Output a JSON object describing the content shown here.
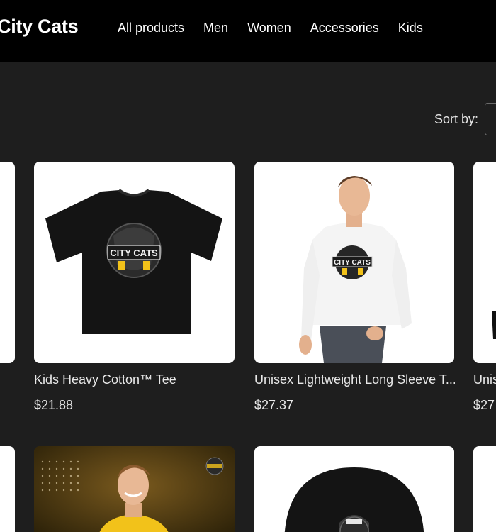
{
  "brand": {
    "name": "City Cats"
  },
  "nav": {
    "items": [
      "All products",
      "Men",
      "Women",
      "Accessories",
      "Kids"
    ]
  },
  "sort": {
    "label": "Sort by:"
  },
  "products": [
    {
      "title": "Kids Heavy Cotton™ Tee",
      "price": "$21.88",
      "logo_text": "CITY CATS"
    },
    {
      "title": "Unisex Lightweight Long Sleeve T...",
      "price": "$27.37",
      "logo_text": "CITY CATS"
    },
    {
      "title": "Unis",
      "price": "$27"
    }
  ],
  "colors": {
    "header_bg": "#000000",
    "page_bg": "#1e1e1e",
    "card_bg": "#ffffff",
    "logo_yellow": "#f2c21a"
  }
}
